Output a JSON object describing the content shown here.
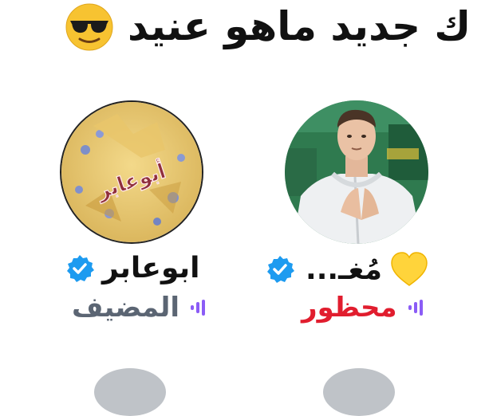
{
  "header": {
    "title": "ك جديد ماهو عنيد",
    "emoji": "smiling-face-with-sunglasses"
  },
  "participants": [
    {
      "name": "ابوعابر",
      "verified": true,
      "role": "المضيف",
      "role_color": "#5b6573",
      "avatar_overlay_text": "أبوعابر"
    },
    {
      "name": "مُغـ...",
      "verified": true,
      "role": "محظور",
      "role_color": "#e11d2e",
      "name_emoji": "yellow-heart"
    }
  ],
  "colors": {
    "verified_badge": "#1d9bf0",
    "audio_bars": "#8b5cf6"
  }
}
